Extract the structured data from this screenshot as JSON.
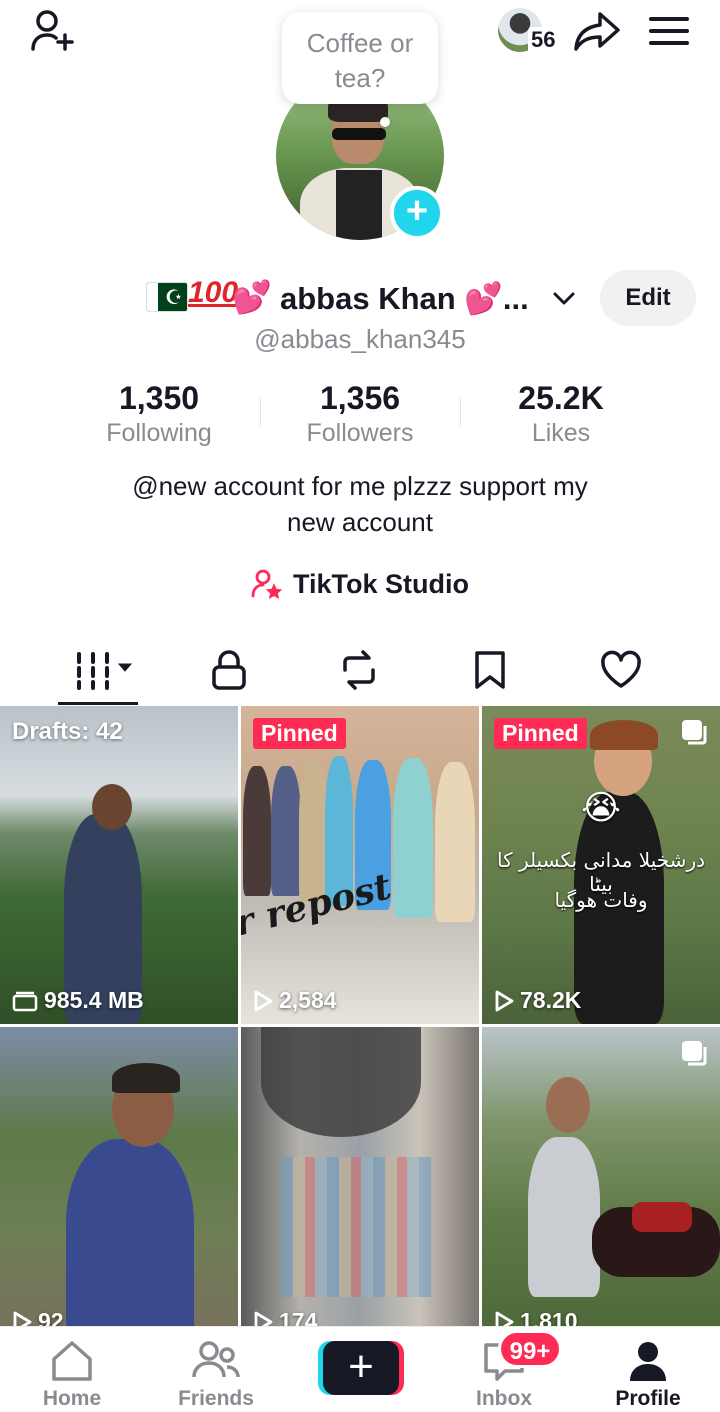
{
  "header": {
    "story_count": "56"
  },
  "bubble": {
    "text_line1": "Coffee or",
    "text_line2": "tea?"
  },
  "profile": {
    "flag_emoji": "☪",
    "hundred_emoji": "100",
    "hearts_emoji": "💕",
    "display_name": "abbas Khan 💕...",
    "username": "@abbas_khan345",
    "edit_label": "Edit",
    "bio_line1": "@new account for me plzzz support my",
    "bio_line2": "new account",
    "studio_label": "TikTok Studio"
  },
  "stats": [
    {
      "value": "1,350",
      "label": "Following"
    },
    {
      "value": "1,356",
      "label": "Followers"
    },
    {
      "value": "25.2K",
      "label": "Likes"
    }
  ],
  "tabs": [
    {
      "icon": "grid-videos-icon"
    },
    {
      "icon": "lock-icon"
    },
    {
      "icon": "repost-icon"
    },
    {
      "icon": "bookmark-icon"
    },
    {
      "icon": "heart-icon"
    }
  ],
  "grid": {
    "drafts_label": "Drafts: 42",
    "pinned_label": "Pinned",
    "repost_text": "r repost",
    "urdu_line1": "درشخیلا مدانی بکسیلر کا بیٹا",
    "urdu_line2": "وفات ھوگیا",
    "crying_emoji": "😭",
    "items": [
      {
        "views": "985.4 MB"
      },
      {
        "views": "2,584"
      },
      {
        "views": "78.2K"
      },
      {
        "views": "92"
      },
      {
        "views": "174"
      },
      {
        "views": "1,810"
      }
    ]
  },
  "nav": {
    "home": "Home",
    "friends": "Friends",
    "create": "+",
    "inbox": "Inbox",
    "inbox_badge": "99+",
    "profile": "Profile"
  },
  "colors": {
    "accent_red": "#fe2c55",
    "accent_cyan": "#20d5ec",
    "text_primary": "#161823",
    "text_secondary": "#8a8b91"
  }
}
